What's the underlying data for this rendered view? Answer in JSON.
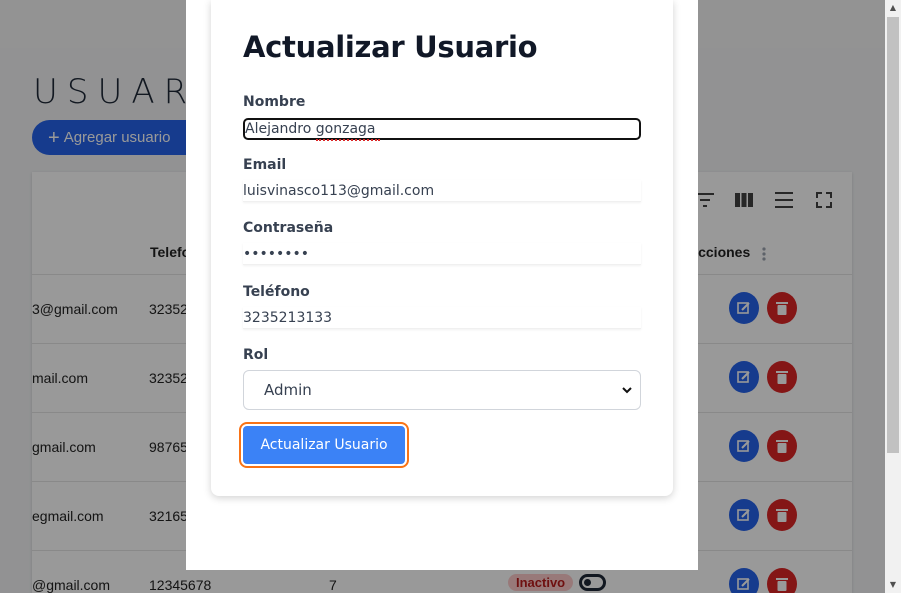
{
  "page": {
    "title": "USUARIOS",
    "add_button_label": "Agregar usuario",
    "table": {
      "headers": {
        "telefono": "Telefono",
        "acciones": "Acciones"
      },
      "rows": [
        {
          "email": "3@gmail.com",
          "telefono": "32352",
          "id": "",
          "estado": ""
        },
        {
          "email": "mail.com",
          "telefono": "32352",
          "id": "",
          "estado": ""
        },
        {
          "email": "gmail.com",
          "telefono": "98765",
          "id": "",
          "estado": ""
        },
        {
          "email": "egmail.com",
          "telefono": "32165",
          "id": "",
          "estado": ""
        },
        {
          "email": "@gmail.com",
          "telefono": "12345678",
          "id": "7",
          "estado": "Inactivo"
        }
      ]
    }
  },
  "modal": {
    "title": "Actualizar Usuario",
    "fields": {
      "nombre": {
        "label": "Nombre",
        "value": "Alejandro gonzaga"
      },
      "email": {
        "label": "Email",
        "value": "luisvinasco113@gmail.com"
      },
      "password": {
        "label": "Contraseña",
        "value": "••••••••"
      },
      "telefono": {
        "label": "Teléfono",
        "value": "3235213133"
      },
      "rol": {
        "label": "Rol",
        "value": "Admin"
      }
    },
    "submit_label": "Actualizar Usuario"
  },
  "colors": {
    "primary": "#3b82f6",
    "edit": "#2563eb",
    "delete": "#dc2626",
    "focus_ring": "#f97316"
  }
}
